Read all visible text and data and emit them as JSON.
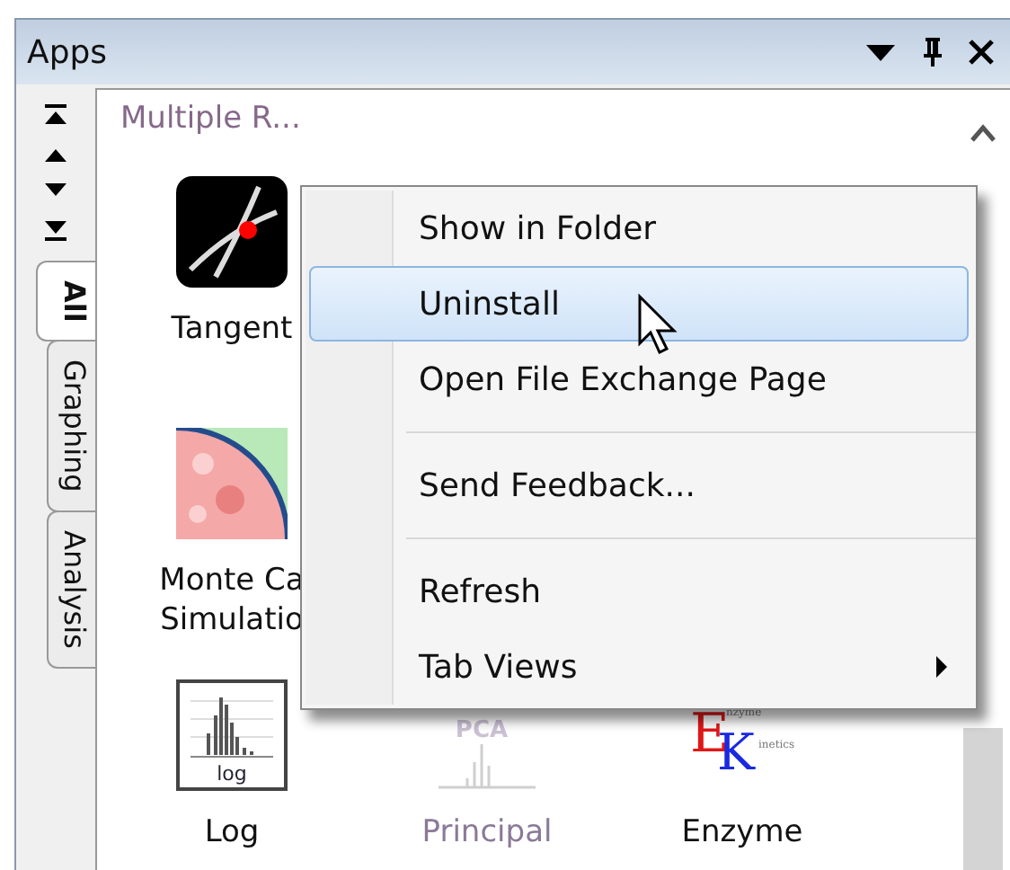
{
  "window": {
    "title": "Apps"
  },
  "side_tabs": [
    {
      "label": "All",
      "selected": true
    },
    {
      "label": "Graphing",
      "selected": false
    },
    {
      "label": "Analysis",
      "selected": false
    }
  ],
  "section": {
    "title": "Multiple R..."
  },
  "rows": [
    [
      {
        "kind": "tangent",
        "label": [
          "Tangent"
        ],
        "disabled": false
      }
    ],
    [
      {
        "kind": "montecarlo",
        "label": [
          "Monte Ca",
          "Simulatio"
        ],
        "disabled": false
      }
    ],
    [
      {
        "kind": "log",
        "icon_text": [
          "log"
        ],
        "label": [
          "Log"
        ],
        "disabled": false
      },
      {
        "kind": "pca",
        "icon_text": [
          "PCA"
        ],
        "label": [
          "Principal"
        ],
        "disabled": true
      },
      {
        "kind": "enzyme",
        "icon_text": [
          "E",
          "nzyme",
          "K",
          "inetics"
        ],
        "label": [
          "Enzyme"
        ],
        "disabled": false
      }
    ]
  ],
  "context_menu": {
    "items": [
      {
        "label": "Show in Folder",
        "selected": false,
        "separator_before": false,
        "submenu": false
      },
      {
        "label": "Uninstall",
        "selected": true,
        "separator_before": false,
        "submenu": false
      },
      {
        "label": "Open File Exchange Page",
        "selected": false,
        "separator_before": false,
        "submenu": false
      },
      {
        "label": "Send Feedback...",
        "selected": false,
        "separator_before": true,
        "submenu": false
      },
      {
        "label": "Refresh",
        "selected": false,
        "separator_before": true,
        "submenu": false
      },
      {
        "label": "Tab Views",
        "selected": false,
        "separator_before": false,
        "submenu": true
      }
    ]
  }
}
